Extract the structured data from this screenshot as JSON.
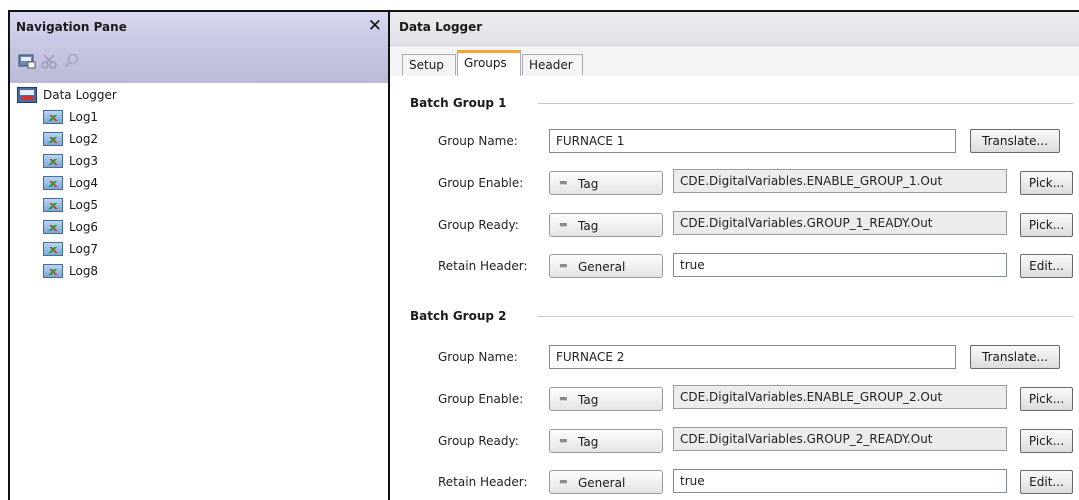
{
  "nav": {
    "title": "Navigation Pane",
    "tree_root": "Data Logger",
    "logs": [
      "Log1",
      "Log2",
      "Log3",
      "Log4",
      "Log5",
      "Log6",
      "Log7",
      "Log8"
    ]
  },
  "editor": {
    "title": "Data Logger",
    "tabs": [
      "Setup",
      "Groups",
      "Header"
    ],
    "active_tab": "Groups"
  },
  "labels": {
    "group_name": "Group Name:",
    "group_enable": "Group Enable:",
    "group_ready": "Group Ready:",
    "retain_header": "Retain Header:"
  },
  "buttons": {
    "translate": "Translate...",
    "pick": "Pick...",
    "edit": "Edit..."
  },
  "groups": [
    {
      "title": "Batch Group 1",
      "name": "FURNACE 1",
      "enable_type": "Tag",
      "enable_value": "CDE.DigitalVariables.ENABLE_GROUP_1.Out",
      "ready_type": "Tag",
      "ready_value": "CDE.DigitalVariables.GROUP_1_READY.Out",
      "retain_type": "General",
      "retain_value": "true"
    },
    {
      "title": "Batch Group 2",
      "name": "FURNACE 2",
      "enable_type": "Tag",
      "enable_value": "CDE.DigitalVariables.ENABLE_GROUP_2.Out",
      "ready_type": "Tag",
      "ready_value": "CDE.DigitalVariables.GROUP_2_READY.Out",
      "retain_type": "General",
      "retain_value": "true"
    }
  ],
  "colors": {
    "active_tab_accent": "#f3a53a",
    "nav_header": "#c8c8e6"
  }
}
